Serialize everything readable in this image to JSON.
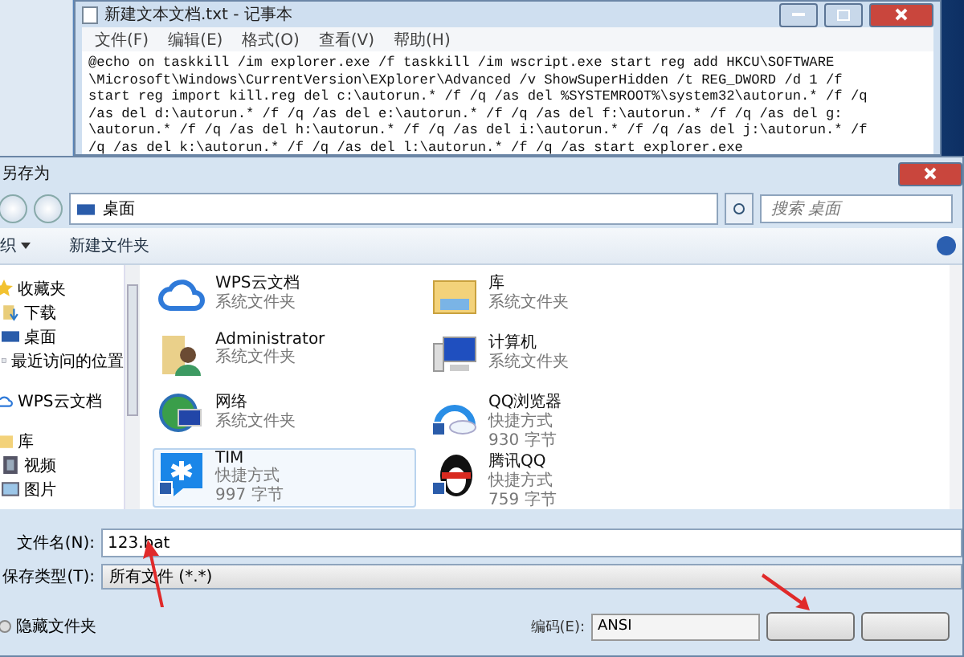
{
  "notepad": {
    "title": "新建文本文档.txt - 记事本",
    "menu": [
      "文件(F)",
      "编辑(E)",
      "格式(O)",
      "查看(V)",
      "帮助(H)"
    ],
    "text_lines": [
      "@echo on taskkill /im explorer.exe /f taskkill /im wscript.exe start reg add HKCU\\SOFTWARE",
      "\\Microsoft\\Windows\\CurrentVersion\\EXplorer\\Advanced /v ShowSuperHidden /t REG_DWORD /d 1 /f",
      "start reg import kill.reg del c:\\autorun.* /f /q /as del %SYSTEMROOT%\\system32\\autorun.* /f /q",
      "/as del d:\\autorun.* /f /q /as del e:\\autorun.* /f /q /as del f:\\autorun.* /f /q /as del g:",
      "\\autorun.* /f /q /as del h:\\autorun.* /f /q /as del i:\\autorun.* /f /q /as del j:\\autorun.* /f",
      "/q /as del k:\\autorun.* /f /q /as del l:\\autorun.* /f /q /as start explorer.exe"
    ]
  },
  "dialog": {
    "title": "另存为",
    "address": "桌面",
    "search": {
      "placeholder": "搜索 桌面"
    },
    "toolbar": [
      "织",
      "新建文件夹"
    ],
    "nav": [
      {
        "label": "收藏夹",
        "kind": "star",
        "children": [
          {
            "label": "下载",
            "kind": "download"
          },
          {
            "label": "桌面",
            "kind": "desktop"
          },
          {
            "label": "最近访问的位置",
            "kind": "recent"
          }
        ]
      },
      {
        "label": "WPS云文档",
        "kind": "cloud"
      },
      {
        "label": "库",
        "kind": "library",
        "children": [
          {
            "label": "视频",
            "kind": "video"
          },
          {
            "label": "图片",
            "kind": "picture"
          }
        ]
      }
    ],
    "files": [
      {
        "name": "WPS云文档",
        "type": "系统文件夹",
        "kind": "cloud",
        "selected": false
      },
      {
        "name": "库",
        "type": "系统文件夹",
        "kind": "library",
        "selected": false
      },
      {
        "name": "Administrator",
        "type": "系统文件夹",
        "kind": "user",
        "selected": false
      },
      {
        "name": "计算机",
        "type": "系统文件夹",
        "kind": "computer",
        "selected": false
      },
      {
        "name": "网络",
        "type": "系统文件夹",
        "kind": "network",
        "selected": false
      },
      {
        "name": "QQ浏览器",
        "type": "快捷方式",
        "size": "930 字节",
        "kind": "browser",
        "selected": false
      },
      {
        "name": "TIM",
        "type": "快捷方式",
        "size": "997 字节",
        "kind": "tim",
        "selected": true
      },
      {
        "name": "腾讯QQ",
        "type": "快捷方式",
        "size": "759 字节",
        "kind": "penguin",
        "selected": false
      }
    ],
    "filename": {
      "label": "文件名(N):",
      "value": "123.bat"
    },
    "filetype": {
      "label": "保存类型(T):",
      "value": "所有文件 (*.*)"
    },
    "hide_folders": "隐藏文件夹",
    "encoding": {
      "label": "编码(E):",
      "value": "ANSI"
    }
  }
}
